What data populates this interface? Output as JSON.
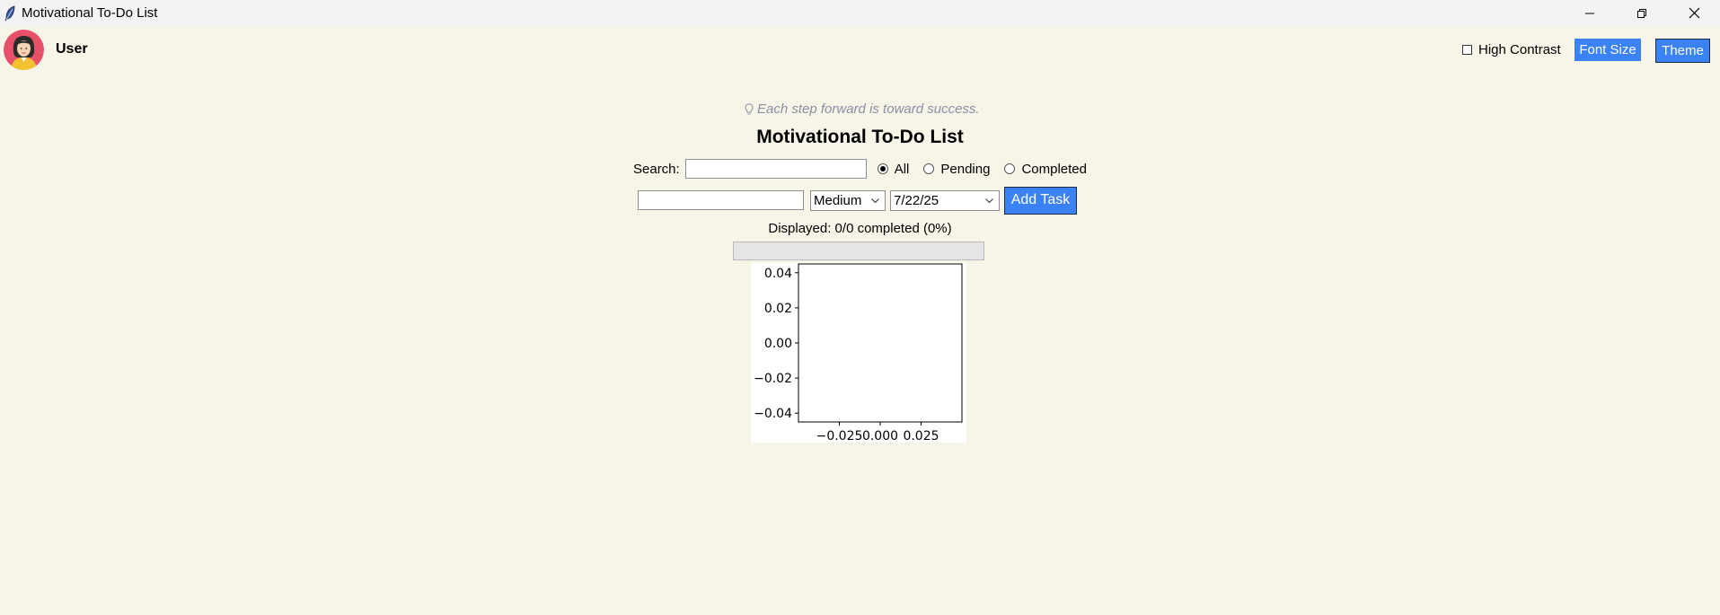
{
  "window": {
    "title": "Motivational To-Do List",
    "app_icon": "feather-icon",
    "controls": [
      "minimize-icon",
      "restore-icon",
      "close-icon"
    ]
  },
  "header": {
    "username": "User",
    "high_contrast_label": "High Contrast",
    "high_contrast_checked": false,
    "font_size_label": "Font Size",
    "theme_label": "Theme"
  },
  "main": {
    "quote": "Each step forward is toward success.",
    "quote_icon": "lightbulb-icon",
    "title": "Motivational To-Do List",
    "search_label": "Search:",
    "search_value": "",
    "filters": [
      {
        "label": "All",
        "checked": true
      },
      {
        "label": "Pending",
        "checked": false
      },
      {
        "label": "Completed",
        "checked": false
      }
    ],
    "task_input_value": "",
    "priority_selected": "Medium",
    "date_selected": "7/22/25",
    "add_task_label": "Add Task",
    "status_text": "Displayed: 0/0 completed (0%)",
    "progress_fraction": 0
  },
  "colors": {
    "background": "#f7f5e7",
    "accent": "#3b82f6",
    "quote_text": "#8a8fa3"
  },
  "chart_data": {
    "type": "scatter",
    "series": [],
    "xlim": [
      -0.05,
      0.05
    ],
    "ylim": [
      -0.045,
      0.045
    ],
    "x_ticks": [
      -0.025,
      0.0,
      0.025
    ],
    "x_tick_labels": [
      "−0.025",
      "0.000",
      "0.025"
    ],
    "y_ticks": [
      0.04,
      0.02,
      0.0,
      -0.02,
      -0.04
    ],
    "y_tick_labels": [
      "0.04",
      "0.02",
      "0.00",
      "−0.02",
      "−0.04"
    ],
    "grid": false
  }
}
